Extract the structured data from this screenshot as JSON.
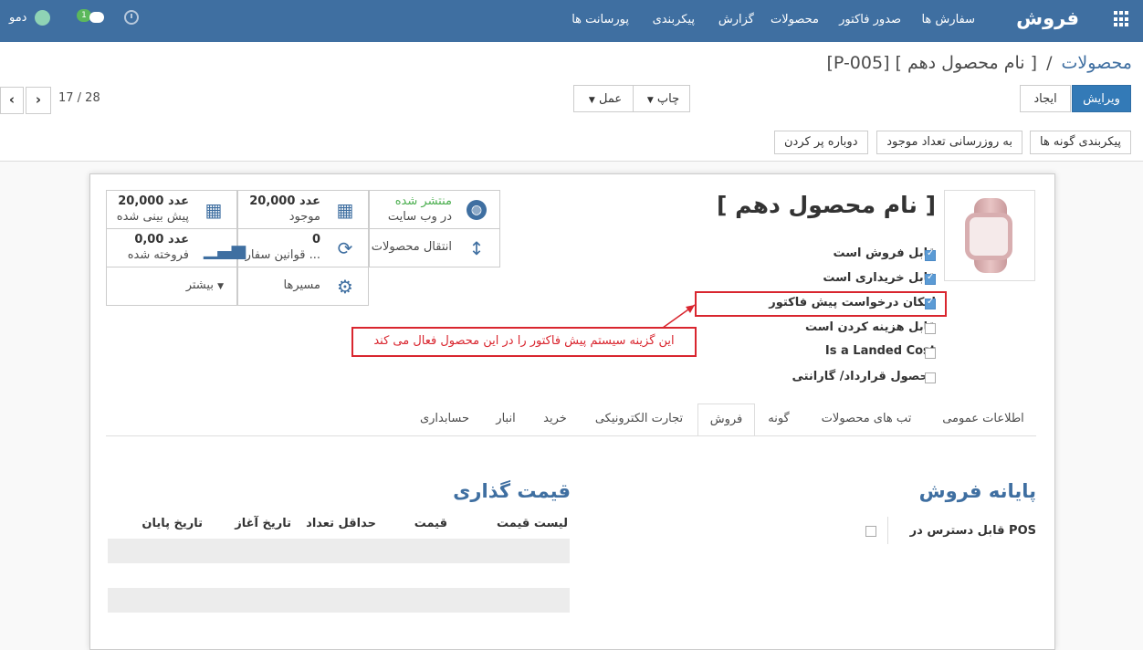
{
  "navbar": {
    "brand": "فروش",
    "menu": [
      "سفارش ها",
      "صدور فاکتور",
      "محصولات",
      "گزارش",
      "پیکربندی",
      "پورسانت ها"
    ],
    "user_name": "دمو",
    "message_count": "1"
  },
  "breadcrumb": {
    "parent": "محصولات",
    "separator": "/",
    "current": "[P-005] [ نام محصول دهم ]"
  },
  "toolbar": {
    "edit_label": "ویرایش",
    "create_label": "ایجاد",
    "print_label": "چاپ",
    "action_label": "عمل",
    "pager_value": "17 / 28"
  },
  "header_buttons": {
    "configure_variants": "پیکربندی گونه ها",
    "update_qty": "به روزرسانی تعداد موجود",
    "refill": "دوباره پر کردن"
  },
  "stat_buttons": {
    "forecast": {
      "value": "20,000 عدد",
      "label": "پیش بینی شده"
    },
    "on_hand": {
      "value": "20,000 عدد",
      "label": "موجود"
    },
    "website": {
      "status": "منتشر شده",
      "label": "در وب سایت"
    },
    "sold": {
      "value": "0,00 عدد",
      "label": "فروخته شده"
    },
    "reorder": {
      "value": "0",
      "label": "قوانین سفارش ..."
    },
    "moves": {
      "label": "انتقال محصولات"
    },
    "more": {
      "label": "بیشتر"
    },
    "routes": {
      "label": "مسیرها"
    }
  },
  "product": {
    "name": "[ نام محصول دهم ]",
    "checkboxes": [
      {
        "label": "قابل فروش است",
        "checked": true
      },
      {
        "label": "قابل خریداری است",
        "checked": true
      },
      {
        "label": "امکان درخواست پیش فاکتور",
        "checked": true
      },
      {
        "label": "قابل هزینه کردن است",
        "checked": false
      },
      {
        "label": "Is a Landed Cost",
        "checked": false
      },
      {
        "label": "محصول قرارداد/ گارانتی",
        "checked": false
      }
    ]
  },
  "annotation": {
    "text": "این گزینه سیستم پیش فاکتور را در این محصول فعال می کند",
    "color": "#d9262f"
  },
  "tabs": [
    "اطلاعات عمومی",
    "تب های محصولات",
    "گونه",
    "فروش",
    "تجارت الکترونیکی",
    "خرید",
    "انبار",
    "حسابداری"
  ],
  "active_tab": "فروش",
  "sales_tab": {
    "pos_title": "پایانه فروش",
    "pos_field": "قابل دسترس در POS",
    "pricing_title": "قیمت گذاری",
    "pricing_columns": [
      "لیست قیمت",
      "قیمت",
      "حداقل تعداد",
      "تاریخ آغاز",
      "تاریخ پایان"
    ]
  },
  "colors": {
    "navbar": "#3f6fa1",
    "primary": "#337ab7",
    "heading": "#3f6fa1",
    "annotation": "#d9262f"
  }
}
